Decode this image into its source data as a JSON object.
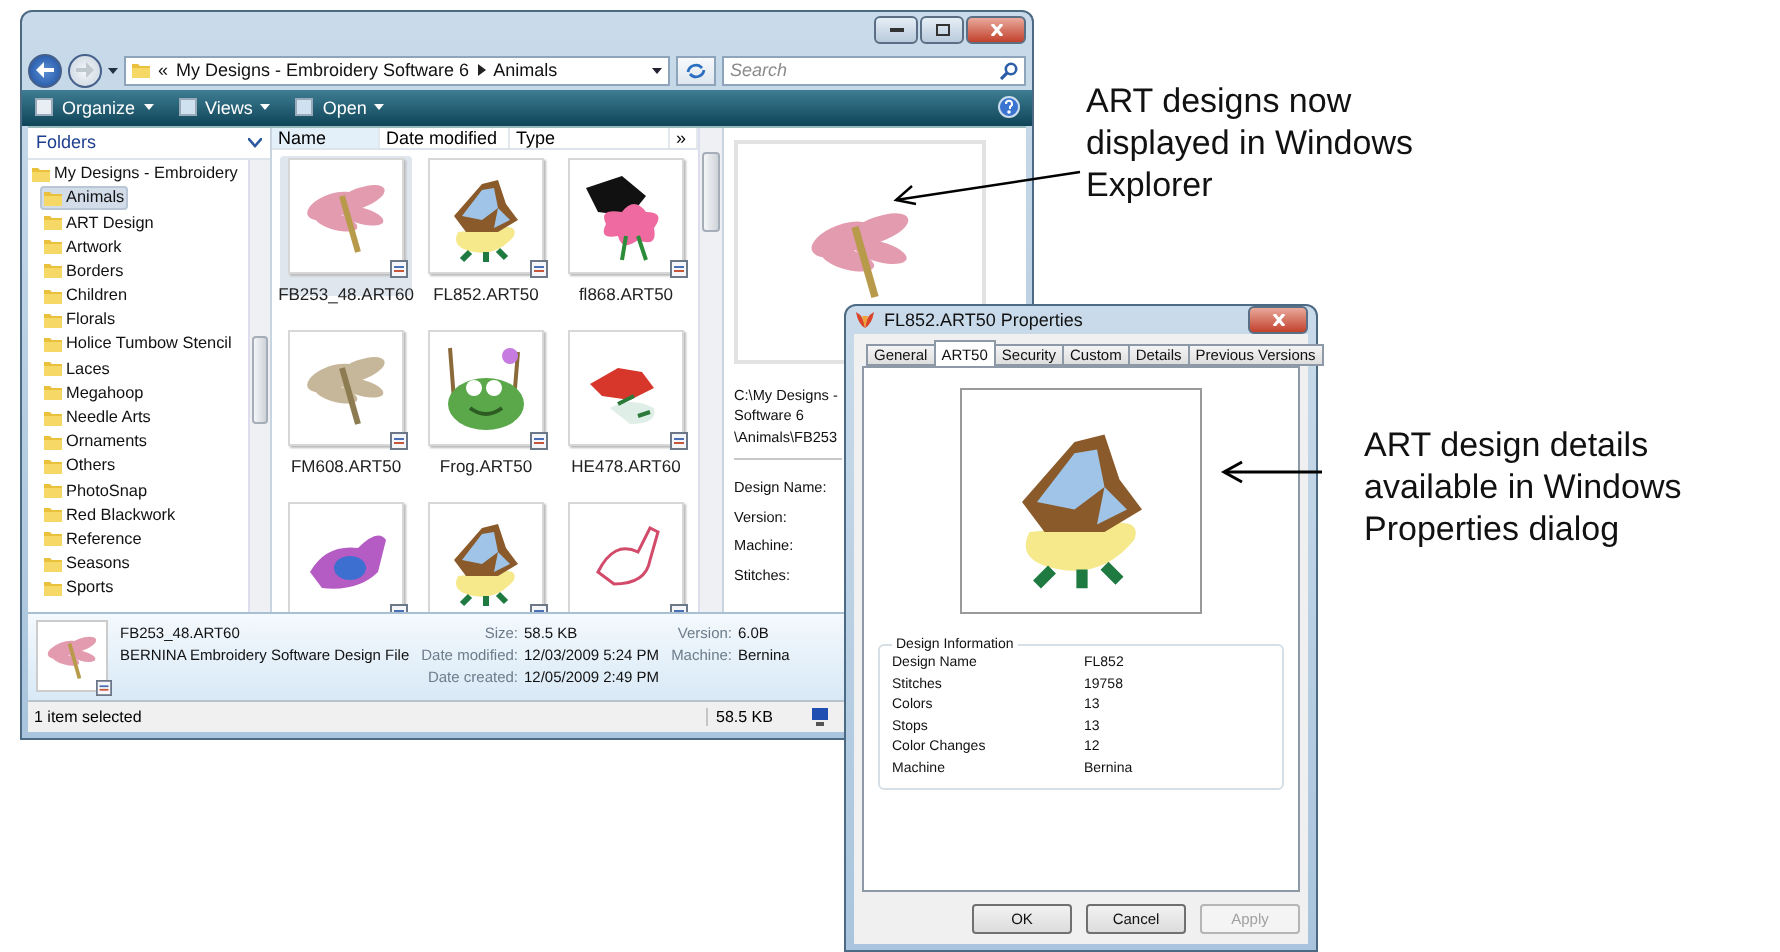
{
  "explorer": {
    "address": {
      "overflow": "«",
      "segments": [
        "My Designs - Embroidery Software 6",
        "Animals"
      ]
    },
    "search": {
      "placeholder": "Search"
    },
    "toolbar": [
      "Organize",
      "Views",
      "Open"
    ],
    "folders_header": "Folders",
    "folders": [
      {
        "label": "My Designs - Embroidery",
        "selected": false,
        "children": [
          {
            "label": "Animals",
            "selected": true
          },
          {
            "label": "ART Design",
            "selected": false
          },
          {
            "label": "Artwork",
            "selected": false
          },
          {
            "label": "Borders",
            "selected": false
          },
          {
            "label": "Children",
            "selected": false
          },
          {
            "label": "Florals",
            "selected": false
          },
          {
            "label": "Holice Tumbow Stencil",
            "selected": false
          },
          {
            "label": "Laces",
            "selected": false
          },
          {
            "label": "Megahoop",
            "selected": false
          },
          {
            "label": "Needle Arts",
            "selected": false
          },
          {
            "label": "Ornaments",
            "selected": false
          },
          {
            "label": "Others",
            "selected": false
          },
          {
            "label": "PhotoSnap",
            "selected": false
          },
          {
            "label": "Red Blackwork",
            "selected": false
          },
          {
            "label": "Reference",
            "selected": false
          },
          {
            "label": "Seasons",
            "selected": false
          },
          {
            "label": "Sports",
            "selected": false
          }
        ]
      }
    ],
    "columns": [
      "Name",
      "Date modified",
      "Type",
      "»"
    ],
    "files": [
      {
        "name": "FB253_48.ART60",
        "selected": true
      },
      {
        "name": "FL852.ART50",
        "selected": false
      },
      {
        "name": "fl868.ART50",
        "selected": false
      },
      {
        "name": "FM608.ART50",
        "selected": false
      },
      {
        "name": "Frog.ART50",
        "selected": false
      },
      {
        "name": "HE478.ART60",
        "selected": false
      },
      {
        "selected": false
      },
      {
        "selected": false
      },
      {
        "selected": false
      }
    ],
    "preview": {
      "path_lines": [
        "C:\\My Designs -",
        "Software 6",
        "\\Animals\\FB253"
      ],
      "fields": [
        "Design Name:",
        "Version:",
        "Machine:",
        "Stitches:"
      ]
    },
    "details": {
      "name": "FB253_48.ART60",
      "type": "BERNINA Embroidery Software Design File",
      "props": [
        {
          "label": "Size:",
          "value": "58.5 KB"
        },
        {
          "label": "Date modified:",
          "value": "12/03/2009 5:24 PM"
        },
        {
          "label": "Date created:",
          "value": "12/05/2009 2:49 PM"
        }
      ],
      "extra": [
        {
          "label": "Version:",
          "value": "6.0B"
        },
        {
          "label": "Machine:",
          "value": "Bernina"
        }
      ]
    },
    "status": {
      "text": "1 item selected",
      "size": "58.5 KB"
    }
  },
  "dialog": {
    "title": "FL852.ART50 Properties",
    "tabs": [
      {
        "label": "General",
        "selected": false
      },
      {
        "label": "ART50",
        "selected": true
      },
      {
        "label": "Security",
        "selected": false
      },
      {
        "label": "Custom",
        "selected": false
      },
      {
        "label": "Details",
        "selected": false
      },
      {
        "label": "Previous Versions",
        "selected": false
      }
    ],
    "group": "Design Information",
    "rows": [
      {
        "label": "Design Name",
        "value": "FL852"
      },
      {
        "label": "Stitches",
        "value": "19758"
      },
      {
        "label": "Colors",
        "value": "13"
      },
      {
        "label": "Stops",
        "value": "13"
      },
      {
        "label": "Color Changes",
        "value": "12"
      },
      {
        "label": "Machine",
        "value": "Bernina"
      }
    ],
    "buttons": [
      {
        "label": "OK",
        "disabled": false
      },
      {
        "label": "Cancel",
        "disabled": false
      },
      {
        "label": "Apply",
        "disabled": true
      }
    ]
  },
  "callouts": [
    {
      "text": "ART designs now displayed in Windows Explorer"
    },
    {
      "text": "ART design details available in Windows Properties dialog"
    }
  ]
}
